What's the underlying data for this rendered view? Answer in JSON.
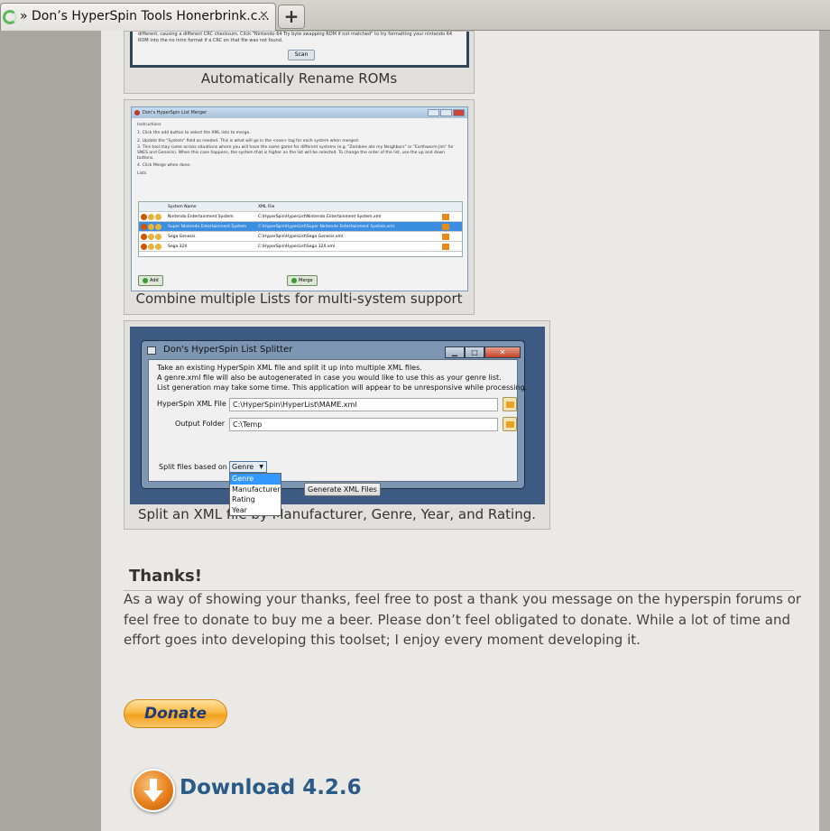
{
  "browser": {
    "tab_title": "» Don’s HyperSpin Tools Honerbrink.c...",
    "tab_close": "✕",
    "new_tab": "+"
  },
  "shot1": {
    "text_line1": "different, causing a different CRC checksum. Click \"Nintendo 64 Try byte swapping ROM if not matched\" to try formatting your nintendo 64",
    "text_line2": "ROM into the no intro format if a CRC on that file was not found.",
    "scan_button": "Scan",
    "caption": "Automatically Rename ROMs"
  },
  "shot2": {
    "window_title": "Don's HyperSpin List Merger",
    "instructions": [
      "Instructions",
      "1. Click the add button to select the XML lists to merge.",
      "2. Update the \"System\" field as needed. This is what will go in the <exe> tag for each system when merged.",
      "3. This tool may come across situations where you will have the same game for different systems (e.g. \"Zombies ate my Neighbors\" or \"Earthworm Jim\" for SNES and Genesis). When this case happens, the system that is higher on the list will be selected. To change the order of the list, use the up and down buttons.",
      "4. Click Merge when done."
    ],
    "lists_label": "Lists",
    "columns": [
      "System Name",
      "XML File"
    ],
    "rows": [
      {
        "system": "Nintendo Entertainment System",
        "file": "C:\\HyperSpin\\HyperList\\Nintendo Entertainment System.xml"
      },
      {
        "system": "Super Nintendo Entertainment System",
        "file": "C:\\HyperSpin\\HyperList\\Super Nintendo Entertainment System.xml"
      },
      {
        "system": "Sega Genesis",
        "file": "C:\\HyperSpin\\HyperList\\Sega Genesis.xml"
      },
      {
        "system": "Sega 32X",
        "file": "C:\\HyperSpin\\HyperList\\Sega 32X.xml"
      }
    ],
    "add_button": "Add",
    "merge_button": "Merge",
    "caption": "Combine multiple Lists for multi-system support"
  },
  "shot3": {
    "window_title": "Don's HyperSpin List Splitter",
    "desc_line1": "Take an existing HyperSpin XML file and split it up into multiple XML files.",
    "desc_line2": "A genre.xml file will also be autogenerated in case you would like to use this as your genre list.",
    "desc_line3": "List generation may take some time. This application will appear to be unresponsive while processing.",
    "xml_label": "HyperSpin XML File",
    "xml_value": "C:\\HyperSpin\\HyperList\\MAME.xml",
    "output_label": "Output Folder",
    "output_value": "C:\\Temp",
    "split_label": "Split files based on",
    "split_value": "Genre",
    "options": [
      "Genre",
      "Manufacturer",
      "Rating",
      "Year"
    ],
    "generate_button": "Generate XML Files",
    "caption": "Split an XML file by Manufacturer, Genre, Year, and Rating."
  },
  "thanks": {
    "heading": "Thanks!",
    "body": "As a way of showing your thanks, feel free to post a thank you message on the hyperspin forums or feel free to donate to buy me a beer. Please don’t feel obligated to donate. While a lot of time and effort goes into developing this toolset; I enjoy every moment developing it."
  },
  "donate_label": "Donate",
  "download": {
    "label": "Download 4.2.6",
    "icon": "download-arrow-icon"
  }
}
